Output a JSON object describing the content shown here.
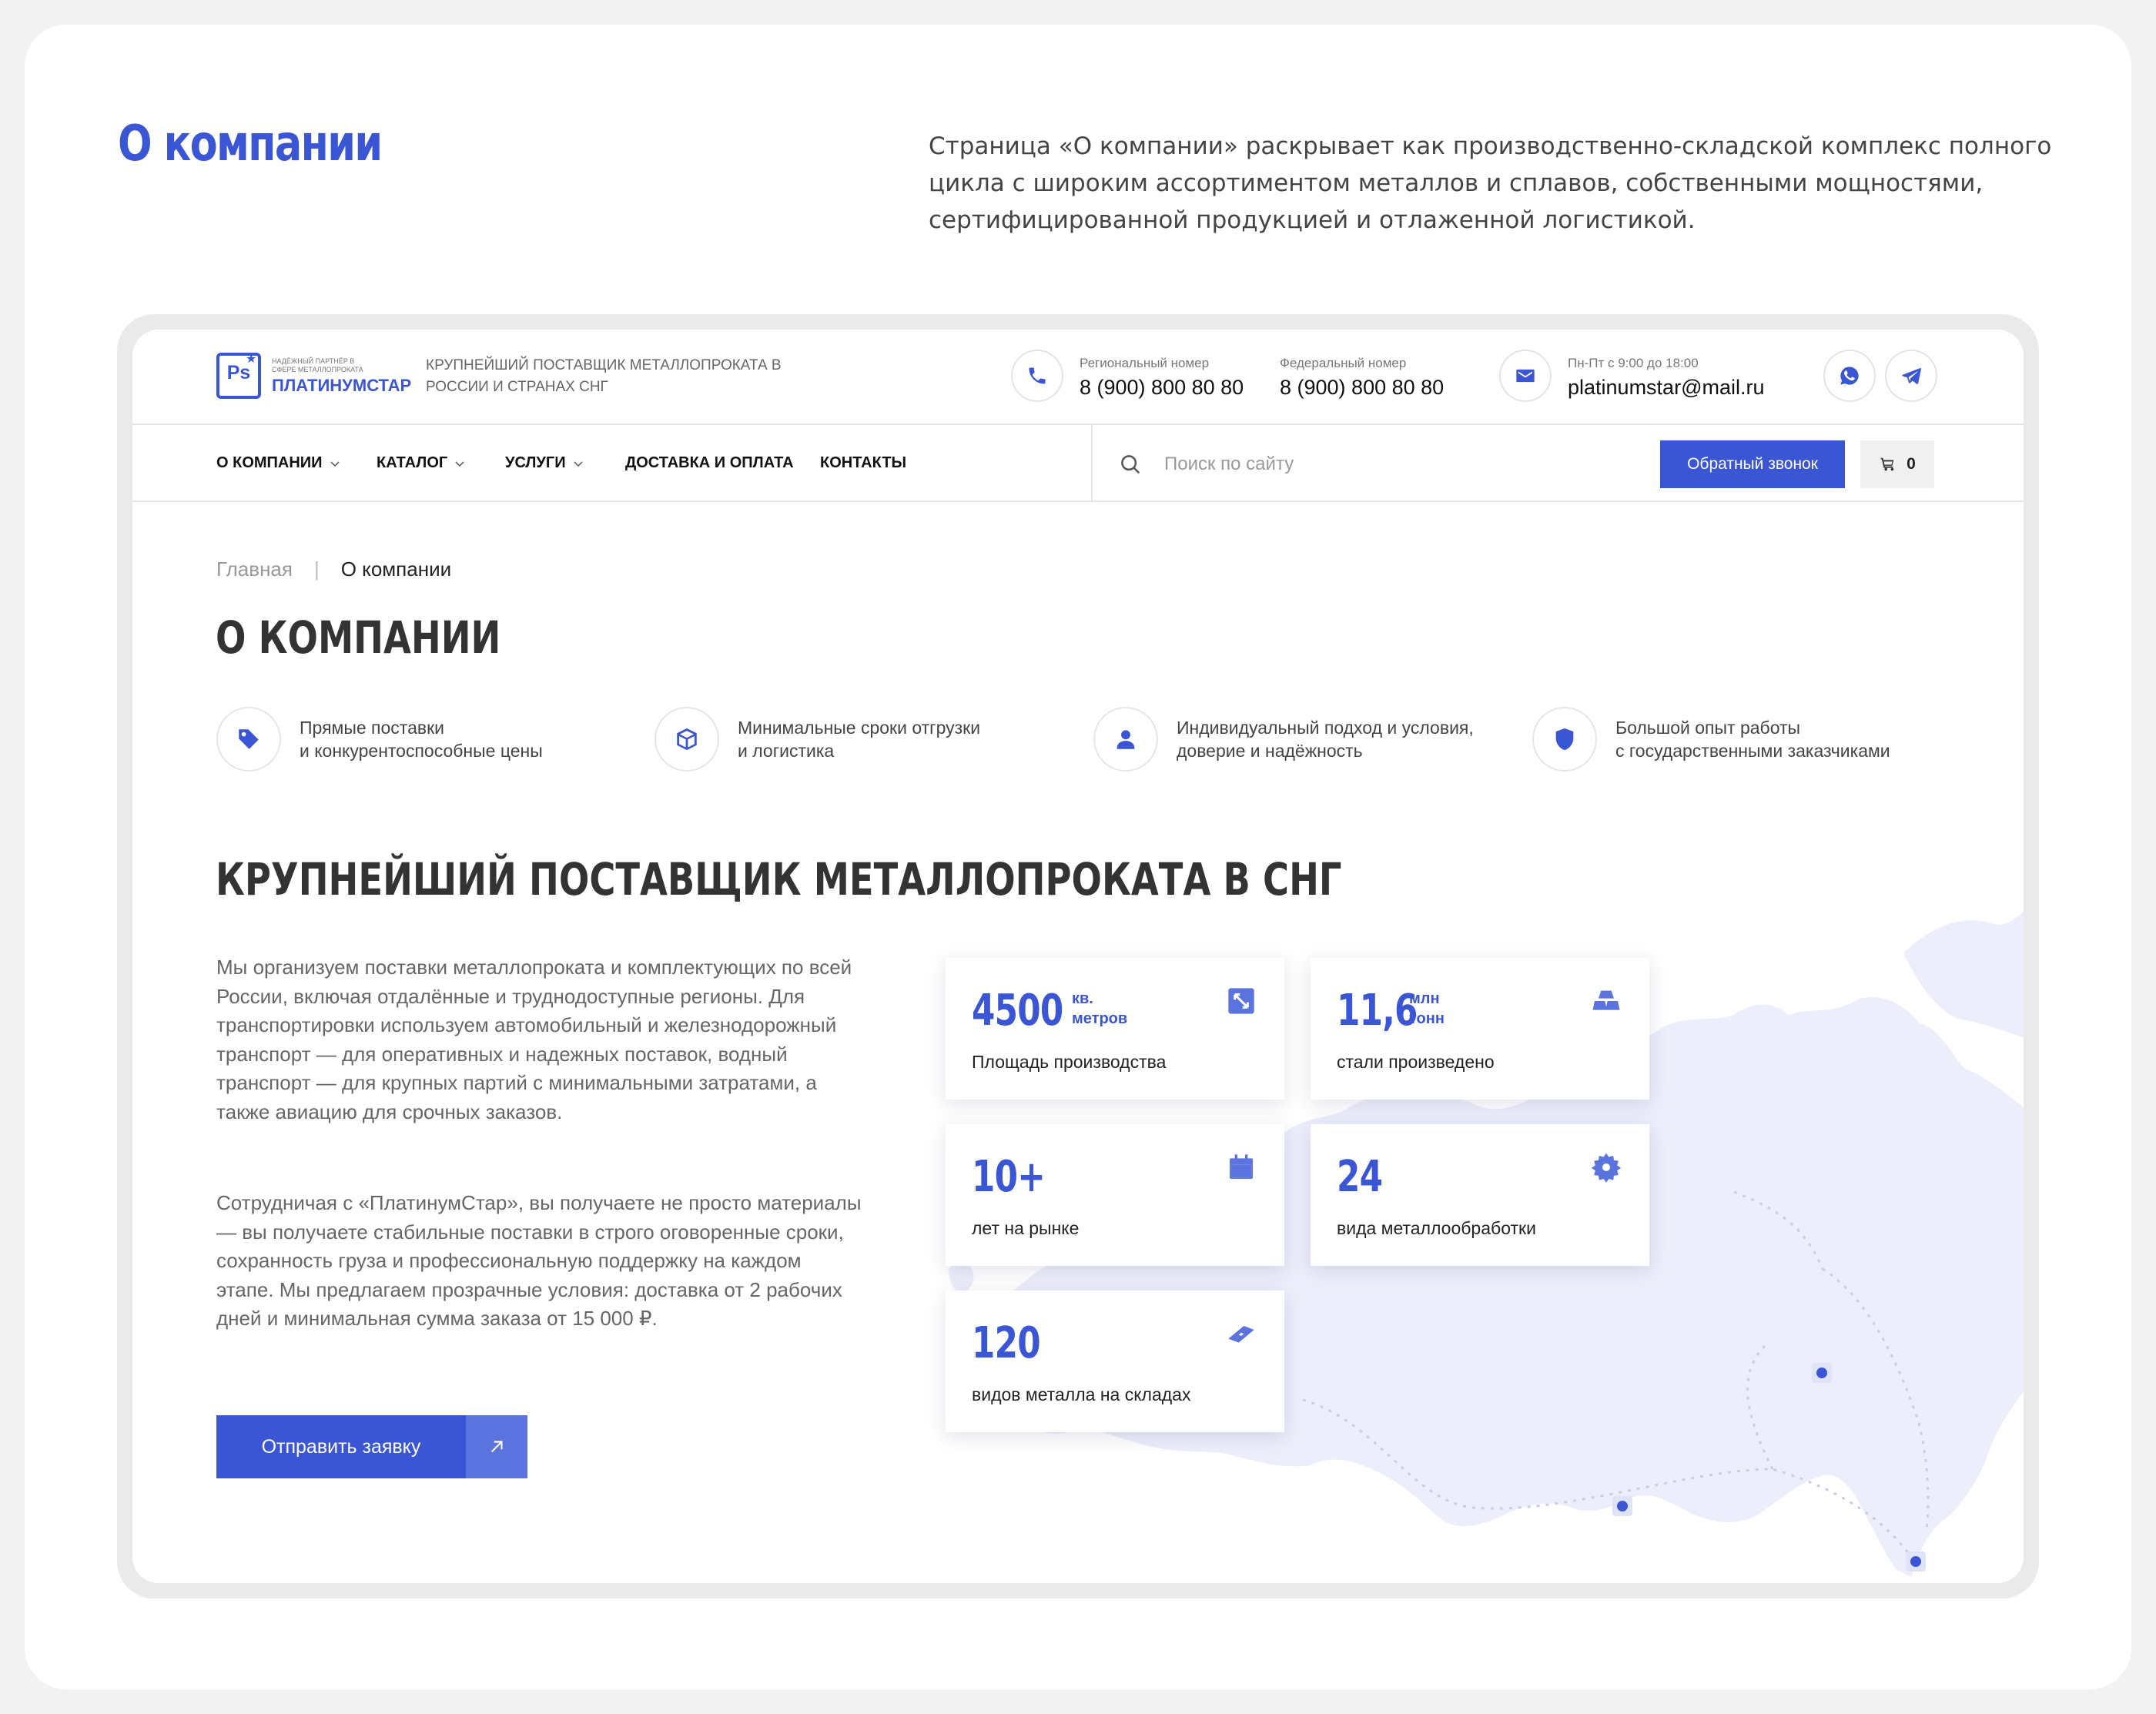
{
  "hero": {
    "title": "О компании",
    "description": "Страница «О компании» раскрывает как производственно-складской комплекс полного цикла с широким ассортиментом металлов и сплавов, собственными мощностями, сертифицированной продукцией и отлаженной логистикой."
  },
  "header": {
    "logo_tagline": "Надёжный партнёр в сфере металлопроката",
    "logo_name": "ПЛАТИНУМСТАР",
    "logo_mark": "Ps",
    "tagline": "Крупнейший поставщик металлопроката в России и странах СНГ",
    "regional_label": "Региональный номер",
    "regional_phone": "8 (900) 800 80 80",
    "federal_label": "Федеральный номер",
    "federal_phone": "8 (900) 800 80 80",
    "hours_label": "Пн-Пт с 9:00 до 18:00",
    "email": "platinumstar@mail.ru"
  },
  "nav": {
    "items": [
      {
        "label": "О КОМПАНИИ",
        "dropdown": true
      },
      {
        "label": "КАТАЛОГ",
        "dropdown": true
      },
      {
        "label": "УСЛУГИ",
        "dropdown": true
      },
      {
        "label": "ДОСТАВКА И ОПЛАТА",
        "dropdown": false
      },
      {
        "label": "КОНТАКТЫ",
        "dropdown": false
      }
    ],
    "search_placeholder": "Поиск по сайту",
    "callback_label": "Обратный звонок",
    "cart_count": "0"
  },
  "breadcrumb": {
    "home": "Главная",
    "separator": "|",
    "current": "О компании"
  },
  "page_title": "О КОМПАНИИ",
  "features": [
    {
      "icon": "tag-icon",
      "line1": "Прямые поставки",
      "line2": "и конкурентоспособные цены"
    },
    {
      "icon": "cube-icon",
      "line1": "Минимальные сроки отгрузки",
      "line2": "и логистика"
    },
    {
      "icon": "user-icon",
      "line1": "Индивидуальный подход и условия,",
      "line2": "доверие и надёжность"
    },
    {
      "icon": "shield-icon",
      "line1": "Большой опыт работы",
      "line2": "с государственными заказчиками"
    }
  ],
  "section_title": "КРУПНЕЙШИЙ  ПОСТАВЩИК МЕТАЛЛОПРОКАТА В СНГ",
  "paragraphs": [
    "Мы организуем поставки металлопроката и комплектующих по всей России, включая отдалённые и труднодоступные регионы. Для транспортировки используем автомобильный и железнодорожный транспорт — для оперативных и надежных поставок, водный транспорт — для крупных партий с минимальными затратами, а также авиацию для срочных заказов.",
    "Сотрудничая с «ПлатинумСтар», вы получаете не просто материалы — вы получаете стабильные поставки в строго оговоренные сроки, сохранность груза и профессиональную поддержку на каждом этапе. Мы предлагаем прозрачные условия: доставка от 2 рабочих дней и минимальная сумма заказа от 15 000 ₽."
  ],
  "submit_label": "Отправить заявку",
  "stats": [
    {
      "value": "4500",
      "unit1": "кв.",
      "unit2": "метров",
      "label": "Площадь производства",
      "icon": "expand-icon"
    },
    {
      "value": "11,6",
      "unit1": "млн",
      "unit2": "тонн",
      "label": "стали произведено",
      "icon": "ingots-icon"
    },
    {
      "value": "10+",
      "unit1": "",
      "unit2": "",
      "label": "лет на рынке",
      "icon": "calendar-icon"
    },
    {
      "value": "24",
      "unit1": "",
      "unit2": "",
      "label": "вида металлообработки",
      "icon": "saw-blade-icon"
    },
    {
      "value": "120",
      "unit1": "",
      "unit2": "",
      "label": "видов металла на складах",
      "icon": "metal-bar-icon"
    }
  ],
  "colors": {
    "accent": "#3a56d4",
    "accent_light": "#5a73de",
    "map_fill": "#eceefb",
    "background": "#f2f2f2"
  }
}
